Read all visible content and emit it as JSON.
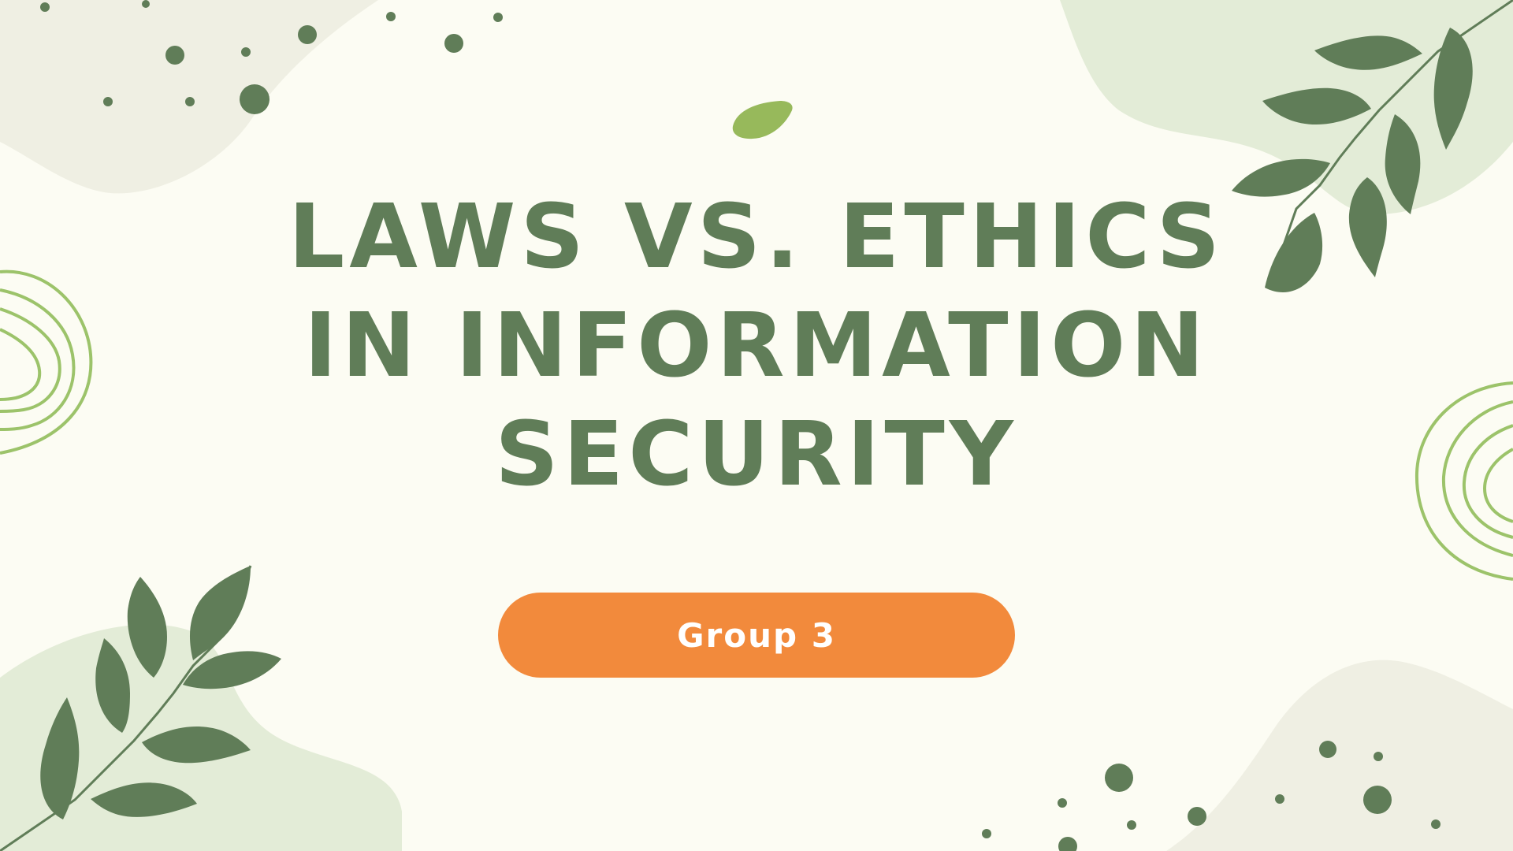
{
  "slide": {
    "title_lines": [
      "LAWS VS. ETHICS",
      "IN INFORMATION",
      "SECURITY"
    ],
    "subtitle_button": "Group 3"
  },
  "colors": {
    "background": "#fcfcf3",
    "title_text": "#607d58",
    "button_fill": "#f28a3c",
    "button_text": "#ffffff",
    "leaf": "#607d58",
    "accent_leaf": "#97b95b",
    "blob_green": "#e3ecd7",
    "blob_beige": "#efefe3",
    "ring_stroke": "#9cc36a",
    "dots": "#607d58"
  },
  "icons": [
    "leaf-branch-icon",
    "concentric-ring-icon",
    "dot-cluster-icon",
    "accent-leaf-icon"
  ]
}
